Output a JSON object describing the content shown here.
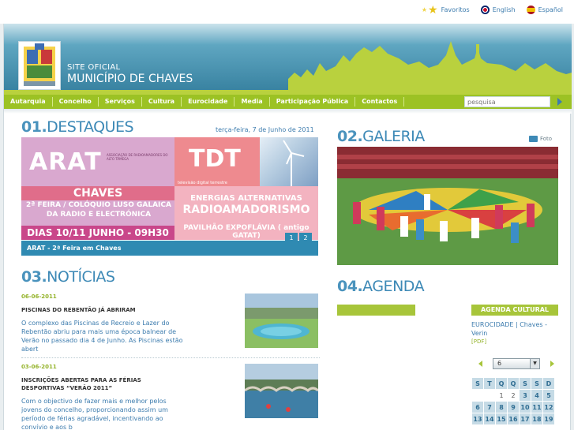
{
  "top_links": {
    "favoritos": "Favoritos",
    "english": "English",
    "espanol": "Español"
  },
  "header": {
    "line1": "SITE OFICIAL",
    "line2": "MUNICÍPIO DE CHAVES"
  },
  "nav": {
    "items": [
      "Autarquia",
      "Concelho",
      "Serviços",
      "Cultura",
      "Eurocidade",
      "Media",
      "Participação Pública",
      "Contactos"
    ],
    "search_placeholder": "pesquisa"
  },
  "destaques": {
    "num": "01.",
    "title": "DESTAQUES",
    "date": "terça-feira, 7 de Junho de 2011",
    "banner": {
      "arat": "ARAT",
      "assoc": "ASSOCIAÇÃO DE RADIOAMADORES DO ALTO TÂMEGA",
      "chaves": "CHAVES",
      "feira": "2ª FEIRA / COLÓQUIO LUSO GALAICA DA RADIO E ELECTRÓNICA",
      "dias": "DIAS 10/11 JUNHO - 09H30",
      "tdt": "TDT",
      "tdt_sub": "televisão digital terrestre",
      "energias": "ENERGIAS ALTERNATIVAS",
      "radio": "RADIOAMADORISMO",
      "pavilhao": "PAVILHÃO EXPOFLÁVIA ( antigo GATAT)"
    },
    "caption": "ARAT - 2ª Feira em Chaves",
    "pages": [
      "1",
      "2"
    ]
  },
  "galeria": {
    "num": "02.",
    "title": "GALERIA",
    "foto_label": "Foto"
  },
  "noticias": {
    "num": "03.",
    "title": "NOTÍCIAS",
    "items": [
      {
        "date": "06-06-2011",
        "title": "PISCINAS DO REBENTÃO JÁ ABRIRAM",
        "body": "O complexo das Piscinas de Recreio e Lazer do Rebentão abriu para mais uma época balnear de Verão no passado dia 4 de Junho. As Piscinas estão abert"
      },
      {
        "date": "03-06-2011",
        "title": "INSCRIÇÕES ABERTAS PARA AS FÉRIAS DESPORTIVAS “VERÃO 2011”",
        "body": "Com o objectivo de fazer mais e melhor pelos jovens do concelho, proporcionando assim um período de férias agradável, incentivando ao convívio e aos b"
      }
    ]
  },
  "agenda": {
    "num": "04.",
    "title": "AGENDA",
    "cultural_label": "AGENDA CULTURAL",
    "event_link": "EUROCIDADE | Chaves - Verin",
    "pdf_label": "[PDF]",
    "month_value": "6",
    "weekday_headers": [
      "S",
      "T",
      "Q",
      "Q",
      "S",
      "S",
      "D"
    ],
    "weeks": [
      [
        "",
        "",
        "1",
        "2",
        "3",
        "4",
        "5"
      ],
      [
        "6",
        "7",
        "8",
        "9",
        "10",
        "11",
        "12"
      ],
      [
        "13",
        "14",
        "15",
        "16",
        "17",
        "18",
        "19"
      ]
    ]
  },
  "colors": {
    "accent_blue": "#3d89b6",
    "nav_green": "#9cc224",
    "date_green": "#94b32a"
  }
}
